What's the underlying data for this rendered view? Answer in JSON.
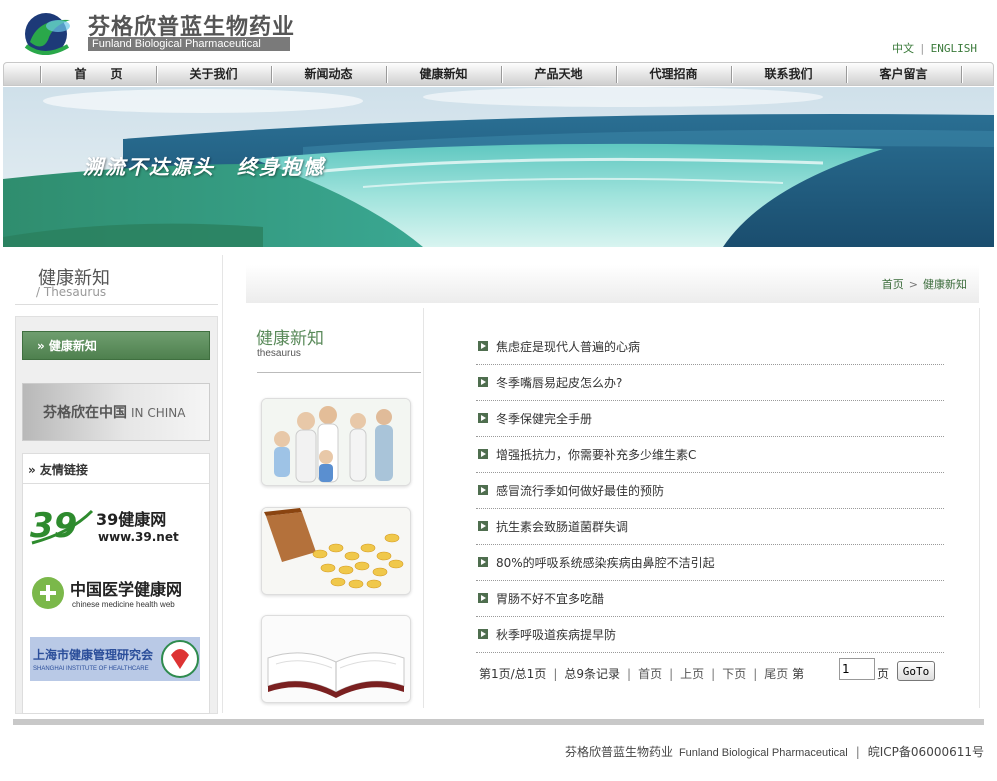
{
  "header": {
    "brand_cn": "芬格欣普蓝生物药业",
    "brand_en": "Funland Biological Pharmaceutical",
    "lang": [
      "中文",
      "ENGLISH"
    ]
  },
  "nav": [
    "首　　页",
    "关于我们",
    "新闻动态",
    "健康新知",
    "产品天地",
    "代理招商",
    "联系我们",
    "客户留言"
  ],
  "banner": {
    "slogan": "溯流不达源头　终身抱憾"
  },
  "left": {
    "title": "健康新知",
    "subtitle": "/ Thesaurus",
    "active_button": "» 健康新知",
    "china_cn": "芬格欣在中国",
    "china_en": "IN CHINA",
    "links_title": "» 友情链接",
    "link_logos": {
      "l39_name": "39健康网",
      "l39_url": "www.39.net",
      "lchina_name": "中国医学健康网",
      "lchina_sub": "chinese medicine health web",
      "lsh_name": "上海市健康管理研究会",
      "lsh_sub": "SHANGHAI INSTITUTE OF HEALTHCARE"
    }
  },
  "breadcrumb": [
    "首页",
    "健康新知"
  ],
  "mid": {
    "title": "健康新知",
    "subtitle": "thesaurus"
  },
  "articles": [
    "焦虑症是现代人普遍的心病",
    "冬季嘴唇易起皮怎么办?",
    "冬季保健完全手册",
    "增强抵抗力，你需要补充多少维生素C",
    "感冒流行季如何做好最佳的预防",
    "抗生素会致肠道菌群失调",
    "80%的呼吸系统感染疾病由鼻腔不洁引起",
    "胃肠不好不宜多吃醋",
    "秋季呼吸道疾病提早防"
  ],
  "pager": {
    "page_info": "第1页/总1页",
    "records": "总9条记录",
    "first": "首页",
    "prev": "上页",
    "next": "下页",
    "last": "尾页",
    "goto_prefix": "第",
    "goto_value": "1",
    "goto_suffix": "页",
    "go_label": "GoTo"
  },
  "footer": {
    "company_cn": "芬格欣普蓝生物药业",
    "company_en": "Funland Biological Pharmaceutical",
    "icp": "皖ICP备06000611号"
  }
}
